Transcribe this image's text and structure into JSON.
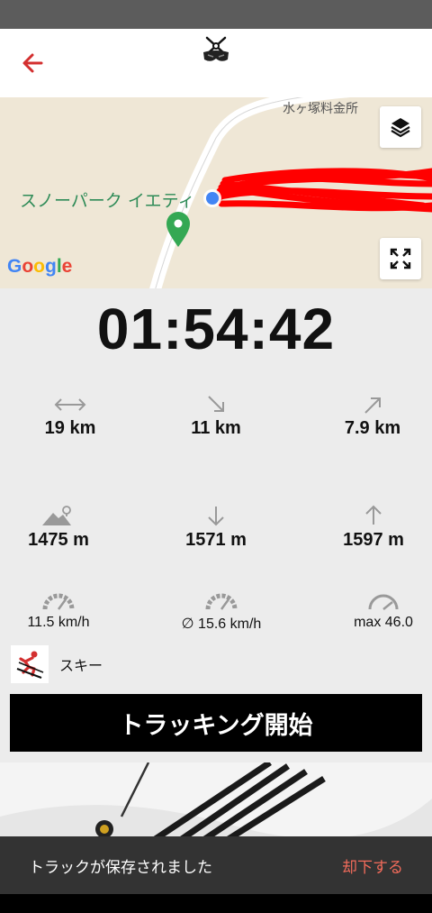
{
  "header": {
    "back_icon": "arrow-left-icon",
    "logo_icon": "ski-goggles-crossed-poles-icon",
    "accent": "#d32f2f"
  },
  "map": {
    "place_label": "スノーパーク イエティ",
    "toll_label": "水ヶ塚料金所",
    "attribution": [
      "G",
      "o",
      "o",
      "g",
      "l",
      "e"
    ],
    "track_color": "#ff0000",
    "layers_icon": "layers-icon",
    "expand_icon": "fullscreen-icon"
  },
  "timer": "01:54:42",
  "stats": {
    "distance": {
      "icon": "horizontal-arrows-icon",
      "value": "19 km"
    },
    "downhill_distance": {
      "icon": "arrow-down-right-icon",
      "value": "11 km"
    },
    "uphill_distance": {
      "icon": "arrow-up-right-icon",
      "value": "7.9 km"
    },
    "altitude": {
      "icon": "mountain-location-icon",
      "value": "1475 m"
    },
    "descent": {
      "icon": "arrow-down-icon",
      "value": "1571 m"
    },
    "ascent": {
      "icon": "arrow-up-icon",
      "value": "1597 m"
    },
    "speed": {
      "icon": "speedometer-icon",
      "value": "11.5 km/h"
    },
    "avg_speed": {
      "icon": "speedometer-icon",
      "value": "∅ 15.6 km/h"
    },
    "max_speed": {
      "icon": "speedometer-icon",
      "value": "max 46.0"
    }
  },
  "sport": {
    "icon": "skier-icon",
    "label": "スキー"
  },
  "start_button": "トラッキング開始",
  "snackbar": {
    "text": "トラックが保存されました",
    "action": "却下する"
  }
}
